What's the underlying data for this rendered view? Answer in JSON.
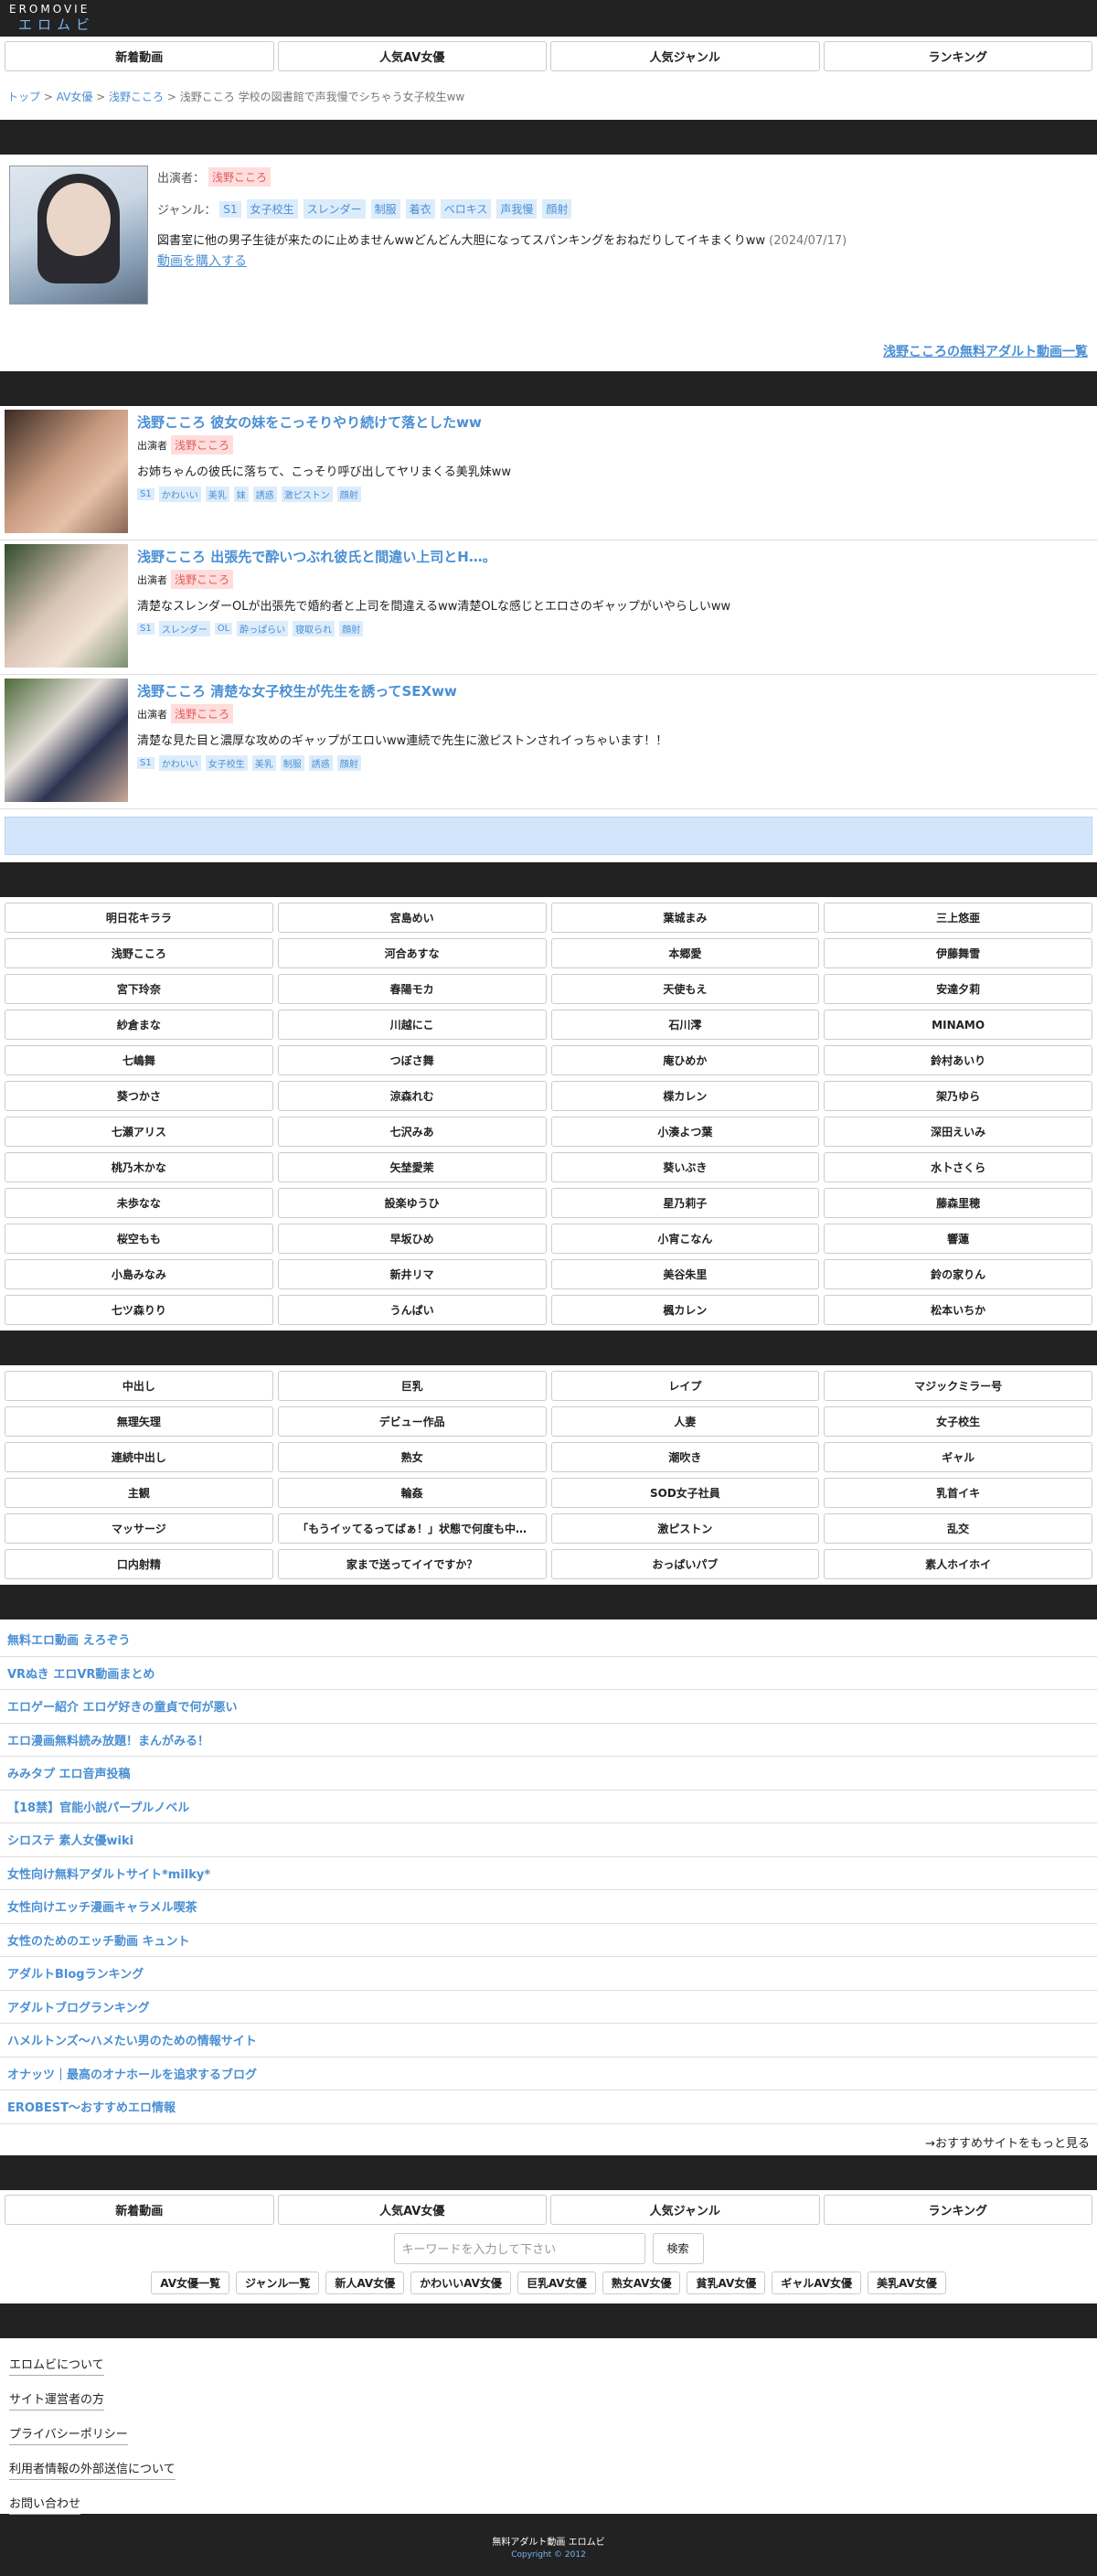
{
  "header": {
    "logo_top": "EROMOVIE",
    "logo_bottom": "エロムビ"
  },
  "nav": [
    "新着動画",
    "人気AV女優",
    "人気ジャンル",
    "ランキング"
  ],
  "breadcrumb": {
    "home": "トップ",
    "sep": " > ",
    "cat": "AV女優",
    "actress": "浅野こころ",
    "current": "浅野こころ 学校の図書館で声我慢でシちゃう女子校生ww"
  },
  "profile": {
    "actress_label": "出演者：",
    "actress": "浅野こころ",
    "genre_label": "ジャンル：",
    "genres": [
      "S1",
      "女子校生",
      "スレンダー",
      "制服",
      "着衣",
      "ベロキス",
      "声我慢",
      "顔射"
    ],
    "desc": "図書室に他の男子生徒が来たのに止めませんwwどんどん大胆になってスパンキングをおねだりしてイキまくりww",
    "date": "(2024/07/17)",
    "buy": "動画を購入する",
    "more": "浅野こころの無料アダルト動画一覧"
  },
  "videos": [
    {
      "title": "浅野こころ 彼女の妹をこっそりやり続けて落としたww",
      "actress_label": "出演者",
      "actress": "浅野こころ",
      "desc": "お姉ちゃんの彼氏に落ちて、こっそり呼び出してヤリまくる美乳妹ww",
      "tags": [
        "S1",
        "かわいい",
        "美乳",
        "妹",
        "誘惑",
        "激ピストン",
        "顔射"
      ]
    },
    {
      "title": "浅野こころ 出張先で酔いつぶれ彼氏と間違い上司とH…。",
      "actress_label": "出演者",
      "actress": "浅野こころ",
      "desc": "清楚なスレンダーOLが出張先で婚約者と上司を間違えるww清楚OLな感じとエロさのギャップがいやらしいww",
      "tags": [
        "S1",
        "スレンダー",
        "OL",
        "酔っぱらい",
        "寝取られ",
        "顔射"
      ]
    },
    {
      "title": "浅野こころ 清楚な女子校生が先生を誘ってSEXww",
      "actress_label": "出演者",
      "actress": "浅野こころ",
      "desc": "清楚な見た目と濃厚な攻めのギャップがエロいww連続で先生に激ピストンされイっちゃいます！！",
      "tags": [
        "S1",
        "かわいい",
        "女子校生",
        "美乳",
        "制服",
        "誘惑",
        "顔射"
      ]
    }
  ],
  "actresses": [
    "明日花キララ",
    "宮島めい",
    "葉城まみ",
    "三上悠亜",
    "浅野こころ",
    "河合あすな",
    "本郷愛",
    "伊藤舞雪",
    "宮下玲奈",
    "春陽モカ",
    "天使もえ",
    "安達夕莉",
    "紗倉まな",
    "川越にこ",
    "石川澪",
    "MINAMO",
    "七嶋舞",
    "つぼさ舞",
    "庵ひめか",
    "鈴村あいり",
    "葵つかさ",
    "涼森れむ",
    "楪カレン",
    "架乃ゆら",
    "七瀬アリス",
    "七沢みあ",
    "小湊よつ葉",
    "深田えいみ",
    "桃乃木かな",
    "矢埜愛茉",
    "葵いぶき",
    "水卜さくら",
    "未歩なな",
    "設楽ゆうひ",
    "星乃莉子",
    "藤森里穂",
    "桜空もも",
    "早坂ひめ",
    "小宵こなん",
    "響蓮",
    "小島みなみ",
    "新井リマ",
    "美谷朱里",
    "鈴の家りん",
    "七ツ森りり",
    "うんぱい",
    "楓カレン",
    "松本いちか"
  ],
  "genres": [
    "中出し",
    "巨乳",
    "レイプ",
    "マジックミラー号",
    "無理矢理",
    "デビュー作品",
    "人妻",
    "女子校生",
    "連続中出し",
    "熟女",
    "潮吹き",
    "ギャル",
    "主観",
    "輪姦",
    "SOD女子社員",
    "乳首イキ",
    "マッサージ",
    "「もうイッてるってばぁ！」状態で何度も中…",
    "激ピストン",
    "乱交",
    "口内射精",
    "家まで送ってイイですか？",
    "おっぱいパブ",
    "素人ホイホイ"
  ],
  "sites": [
    "無料エロ動画 えろぞう",
    "VRぬき エロVR動画まとめ",
    "エロゲー紹介 エロゲ好きの童貞で何が悪い",
    "エロ漫画無料読み放題！まんがみる！",
    "みみタプ エロ音声投稿",
    "【18禁】官能小説パープルノベル",
    "シロステ 素人女優wiki",
    "女性向け無料アダルトサイト*milky*",
    "女性向けエッチ漫画キャラメル喫茶",
    "女性のためのエッチ動画 キュント",
    "アダルトBlogランキング",
    "アダルトブログランキング",
    "ハメルトンズ〜ハメたい男のための情報サイト",
    "オナッツ｜最高のオナホールを追求するブログ",
    "EROBEST〜おすすめエロ情報"
  ],
  "sites_more": "→おすすめサイトをもっと見る",
  "search": {
    "placeholder": "キーワードを入力して下さい",
    "button": "検索"
  },
  "quick": [
    "AV女優一覧",
    "ジャンル一覧",
    "新人AV女優",
    "かわいいAV女優",
    "巨乳AV女優",
    "熟女AV女優",
    "貧乳AV女優",
    "ギャルAV女優",
    "美乳AV女優"
  ],
  "footer_links": [
    "エロムビについて",
    "サイト運営者の方",
    "プライバシーポリシー",
    "利用者情報の外部送信について",
    "お問い合わせ"
  ],
  "footer": {
    "title": "無料アダルト動画 エロムビ",
    "copyright": "Copyright © 2012"
  },
  "colors": {
    "accent": "#4a8fd4",
    "dark": "#222222",
    "pink_tag": "#e05b5b",
    "banner": "#d2e6fb"
  }
}
